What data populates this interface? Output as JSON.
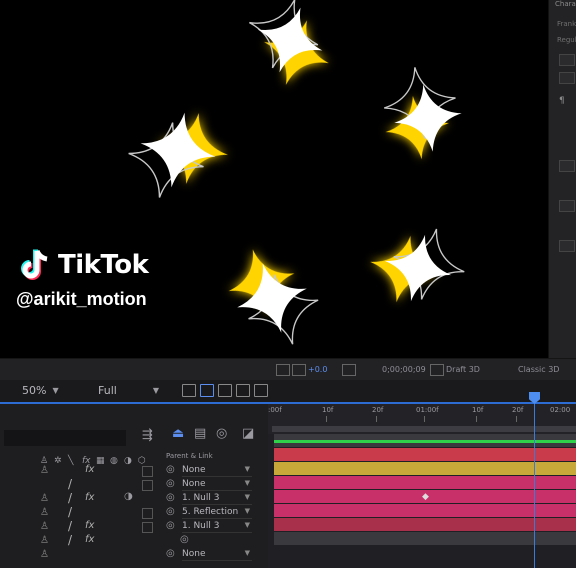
{
  "right_panel": {
    "title": "Character",
    "lines": [
      "Frankl",
      "Regular"
    ],
    "icon": "paragraph-icon"
  },
  "watermark": {
    "brand": "TikTok",
    "handle": "@arikit_motion"
  },
  "viewer": {
    "zoom": "50%",
    "resolution": "Full",
    "exposure": "+0.0",
    "timecode": "0;00;00;09",
    "draft": "Draft 3D",
    "renderer": "Classic 3D"
  },
  "timeline": {
    "parent_header": "Parent & Link",
    "ruler_ticks": [
      ":00f",
      "10f",
      "20f",
      "01:00f",
      "10f",
      "20f",
      "02:00"
    ],
    "layers": [
      {
        "parent": "None",
        "fx": true,
        "switch": ""
      },
      {
        "parent": "None",
        "fx": false,
        "switch": "/"
      },
      {
        "parent": "1. Null 3",
        "fx": true,
        "switch": "/"
      },
      {
        "parent": "5. Reflection",
        "fx": false,
        "switch": "/"
      },
      {
        "parent": "1. Null 3",
        "fx": true,
        "switch": "/"
      },
      {
        "parent": "",
        "fx": true,
        "switch": "/"
      },
      {
        "parent": "None",
        "fx": false,
        "switch": ""
      }
    ],
    "bar_colors": [
      "#3a3a3e",
      "#c93a4a",
      "#c9a83a",
      "#c8306a",
      "#c8306a",
      "#c8306a",
      "#a8304a"
    ],
    "track_color": "#2fd14a",
    "playhead_color": "#3b7bd8"
  }
}
